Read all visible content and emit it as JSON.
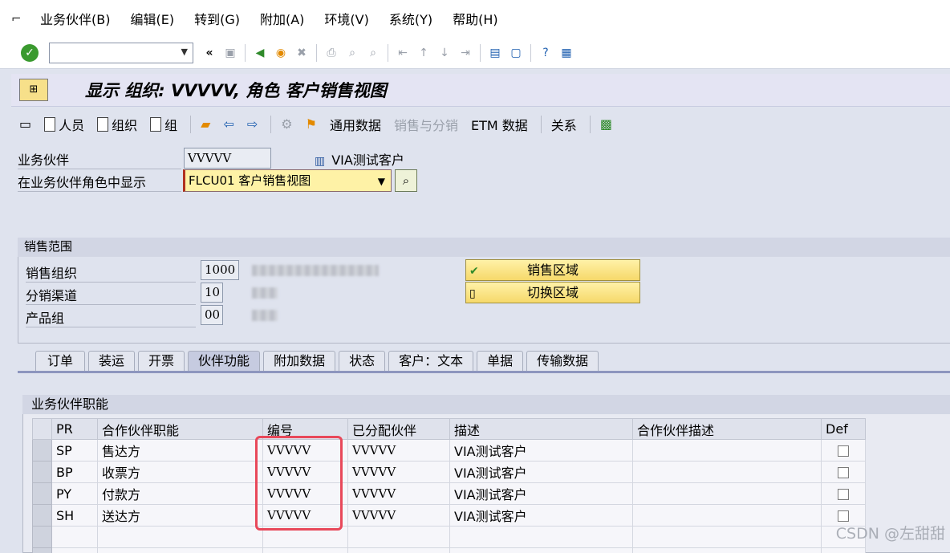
{
  "menu": [
    "业务伙伴(B)",
    "编辑(E)",
    "转到(G)",
    "附加(A)",
    "环境(V)",
    "系统(Y)",
    "帮助(H)"
  ],
  "title": "显示 组织: VVVVV, 角色 客户销售视图",
  "app_toolbar": {
    "person": "人员",
    "organization": "组织",
    "group": "组",
    "general_data": "通用数据",
    "sales_distribution": "销售与分销",
    "etm_data": "ETM 数据",
    "relationships": "关系"
  },
  "header": {
    "bp_label": "业务伙伴",
    "bp_value": "VVVVV",
    "bp_name": "VIA测试客户",
    "role_label": "在业务伙伴角色中显示",
    "role_value": "FLCU01 客户销售视图"
  },
  "sales_area": {
    "title": "销售范围",
    "sales_org_label": "销售组织",
    "sales_org_value": "1000",
    "dist_channel_label": "分销渠道",
    "dist_channel_value": "10",
    "division_label": "产品组",
    "division_value": "00",
    "btn_sales_area": "销售区域",
    "btn_switch_area": "切换区域"
  },
  "tabs": [
    "订单",
    "装运",
    "开票",
    "伙伴功能",
    "附加数据",
    "状态",
    "客户：文本",
    "单据",
    "传输数据"
  ],
  "active_tab": "伙伴功能",
  "partner_functions": {
    "title": "业务伙伴职能",
    "columns": [
      "PR",
      "合作伙伴职能",
      "编号",
      "已分配伙伴",
      "描述",
      "合作伙伴描述",
      "Def"
    ],
    "rows": [
      {
        "pr": "SP",
        "func": "售达方",
        "num": "VVVVV",
        "assigned": "VVVVV",
        "desc": "VIA测试客户",
        "pdesc": "",
        "def": false
      },
      {
        "pr": "BP",
        "func": "收票方",
        "num": "VVVVV",
        "assigned": "VVVVV",
        "desc": "VIA测试客户",
        "pdesc": "",
        "def": false
      },
      {
        "pr": "PY",
        "func": "付款方",
        "num": "VVVVV",
        "assigned": "VVVVV",
        "desc": "VIA测试客户",
        "pdesc": "",
        "def": false
      },
      {
        "pr": "SH",
        "func": "送达方",
        "num": "VVVVV",
        "assigned": "VVVVV",
        "desc": "VIA测试客户",
        "pdesc": "",
        "def": false
      }
    ]
  },
  "watermark": "CSDN @左甜甜",
  "colors": {
    "accent_yellow": "#fef2a6",
    "highlight_red": "#e8485a",
    "ok_green": "#3a9a2f"
  }
}
